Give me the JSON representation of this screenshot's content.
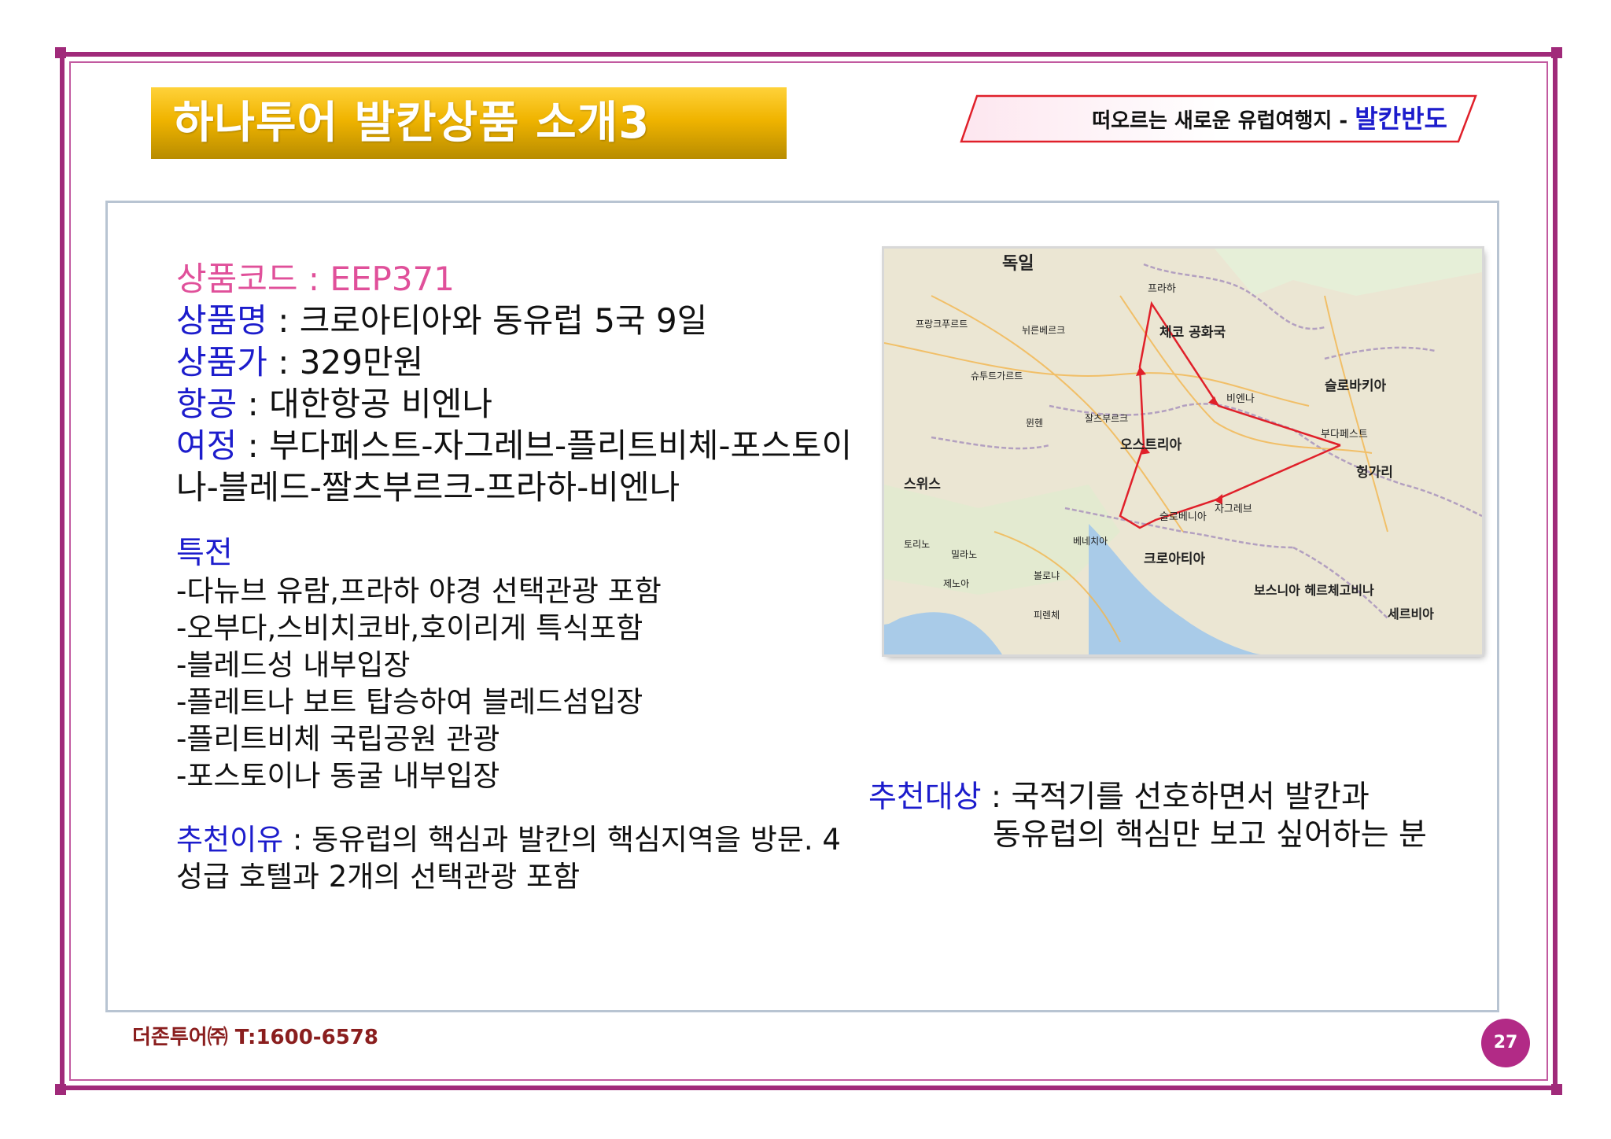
{
  "header": {
    "title": "하나투어 발칸상품 소개3",
    "tagline_prefix": "떠오르는 새로운 유럽여행지 - ",
    "tagline_highlight": "발칸반도"
  },
  "product": {
    "code_label": "상품코드",
    "code_value": " : EEP371",
    "name_label": "상품명",
    "name_value": " : 크로아티아와 동유럽 5국 9일",
    "price_label": "상품가",
    "price_value": " : 329만원",
    "airline_label": "항공",
    "airline_value": " : 대한항공 비엔나",
    "itinerary_label": "여정",
    "itinerary_value": " : 부다페스트-자그레브-플리트비체-포스토이나-블레드-짤츠부르크-프라하-비엔나"
  },
  "benefits": {
    "title": "특전",
    "items": [
      "-다뉴브 유람,프라하 야경 선택관광 포함",
      "-오부다,스비치코바,호이리게 특식포함",
      "-블레드성 내부입장",
      "-플레트나 보트 탑승하여 블레드섬입장",
      "-플리트비체 국립공원 관광",
      "-포스토이나 동굴 내부입장"
    ]
  },
  "reason": {
    "label": "추천이유",
    "text": " : 동유럽의 핵심과 발칸의 핵심지역을 방문. 4성급 호텔과 2개의 선택관광 포함"
  },
  "recommend": {
    "label": "추천대상",
    "line1": " : 국적기를 선호하면서 발칸과",
    "line2": "동유럽의 핵심만 보고 싶어하는 분"
  },
  "map": {
    "labels": {
      "germany": "독일",
      "czech": "체코 공화국",
      "prague": "프라하",
      "austria": "오스트리아",
      "vienna": "비엔나",
      "slovakia": "슬로바키아",
      "budapest": "부다페스트",
      "hungary": "헝가리",
      "switzerland": "스위스",
      "slovenia": "슬로베니아",
      "zagreb": "자그레브",
      "croatia": "크로아티아",
      "bosnia": "보스니아 헤르체고비나",
      "serbia": "세르비아",
      "frankfurt": "프랑크푸르트",
      "nuremberg": "뉘른베르크",
      "stuttgart": "슈투트가르트",
      "munich": "뮌헨",
      "salzburg": "잘츠부르크",
      "milan": "밀라노",
      "venice": "베네치아",
      "genoa": "제노아",
      "turin": "토리노",
      "bologna": "볼로냐",
      "florence": "피렌체"
    }
  },
  "footer": {
    "company": "더존투어㈜ T:1600-6578",
    "page": "27"
  },
  "colors": {
    "frame": "#a02a7a",
    "title_gold": "#f0b400",
    "accent_blue": "#1c1ccc",
    "accent_pink": "#e0509a",
    "route_red": "#e0202a"
  }
}
